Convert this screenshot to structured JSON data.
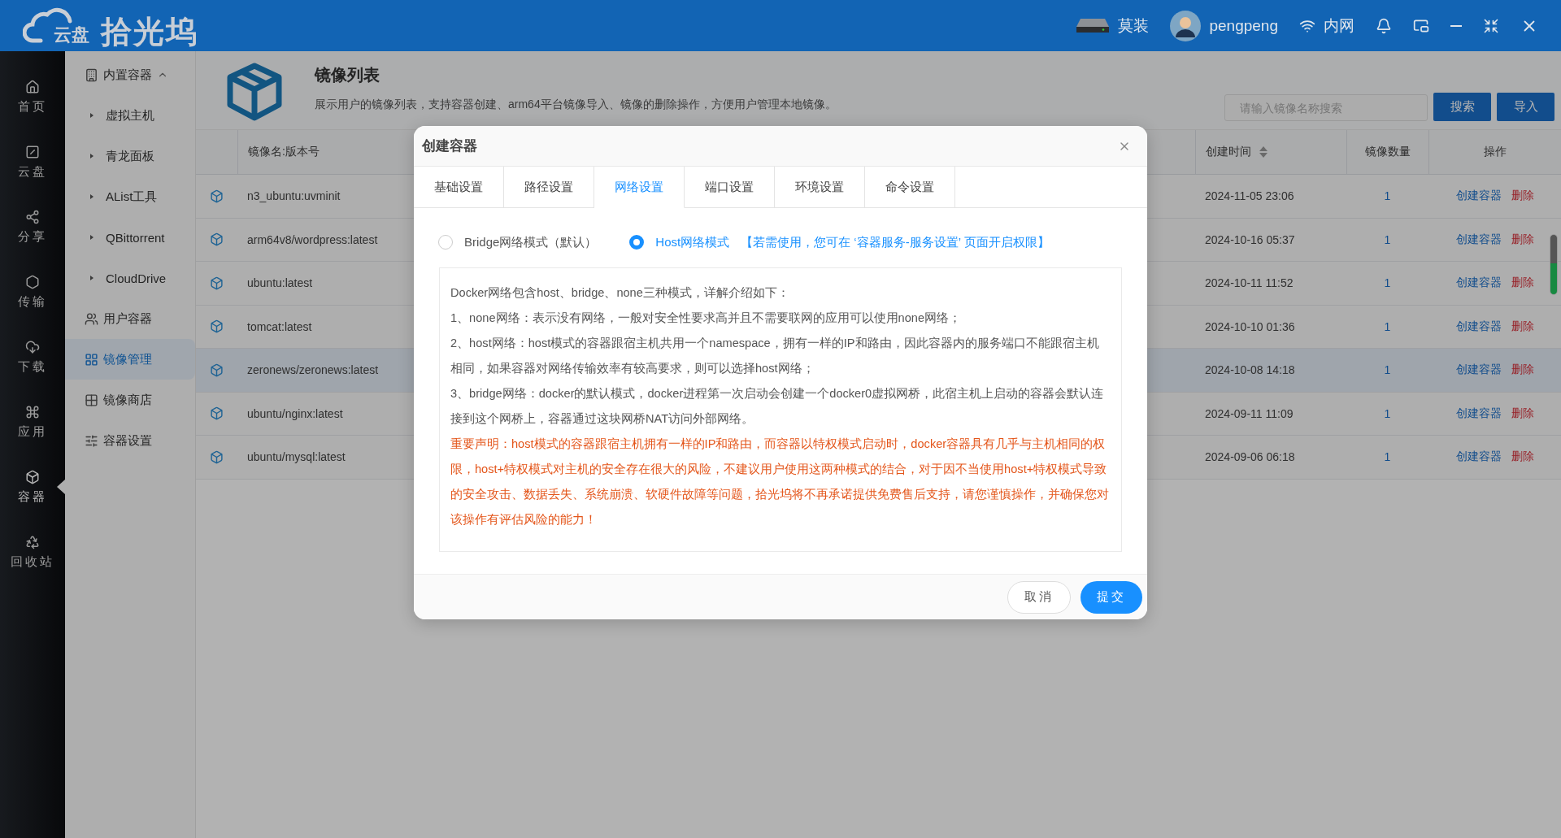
{
  "app": {
    "logo_badge": "云盘",
    "logo_text": "拾光坞"
  },
  "topbar": {
    "device": "莫装",
    "user": "pengpeng",
    "network": "内网"
  },
  "rail": [
    {
      "kind": "home",
      "label": "首页",
      "selected": false
    },
    {
      "kind": "disk",
      "label": "云盘",
      "selected": false
    },
    {
      "kind": "share",
      "label": "分享",
      "selected": false
    },
    {
      "kind": "transfer",
      "label": "传输",
      "selected": false
    },
    {
      "kind": "download",
      "label": "下载",
      "selected": false
    },
    {
      "kind": "apps",
      "label": "应用",
      "selected": false
    },
    {
      "kind": "container",
      "label": "容器",
      "selected": true
    },
    {
      "kind": "recycle",
      "label": "回收站",
      "selected": false
    }
  ],
  "menu": [
    {
      "kind": "builtin",
      "label": "内置容器",
      "expanded": true,
      "selected": false,
      "children": [
        {
          "label": "虚拟主机",
          "selected": false
        },
        {
          "label": "青龙面板",
          "selected": false
        },
        {
          "label": "AList工具",
          "selected": false
        },
        {
          "label": "QBittorrent",
          "selected": false
        },
        {
          "label": "CloudDrive",
          "selected": false
        }
      ]
    },
    {
      "kind": "users",
      "label": "用户容器",
      "selected": false
    },
    {
      "kind": "images",
      "label": "镜像管理",
      "selected": true
    },
    {
      "kind": "store",
      "label": "镜像商店",
      "selected": false
    },
    {
      "kind": "settings",
      "label": "容器设置",
      "selected": false
    }
  ],
  "page": {
    "title": "镜像列表",
    "description": "展示用户的镜像列表，支持容器创建、arm64平台镜像导入、镜像的删除操作，方便用户管理本地镜像。",
    "search": {
      "placeholder": "请输入镜像名称搜索"
    },
    "buttons": [
      "搜索",
      "导入"
    ]
  },
  "table": {
    "columns": [
      "镜像名:版本号",
      "创建时间",
      "镜像数量",
      "操作"
    ],
    "rows": [
      {
        "name": "n3_ubuntu:uvminit",
        "created": "2024-11-05 23:06",
        "count": "1",
        "actions": [
          "创建容器",
          "删除"
        ],
        "selected": false
      },
      {
        "name": "arm64v8/wordpress:latest",
        "created": "2024-10-16 05:37",
        "count": "1",
        "actions": [
          "创建容器",
          "删除"
        ],
        "selected": false
      },
      {
        "name": "ubuntu:latest",
        "created": "2024-10-11 11:52",
        "count": "1",
        "actions": [
          "创建容器",
          "删除"
        ],
        "selected": false
      },
      {
        "name": "tomcat:latest",
        "created": "2024-10-10 01:36",
        "count": "1",
        "actions": [
          "创建容器",
          "删除"
        ],
        "selected": false
      },
      {
        "name": "zeronews/zeronews:latest",
        "created": "2024-10-08 14:18",
        "count": "1",
        "actions": [
          "创建容器",
          "删除"
        ],
        "selected": true
      },
      {
        "name": "ubuntu/nginx:latest",
        "created": "2024-09-11 11:09",
        "count": "1",
        "actions": [
          "创建容器",
          "删除"
        ],
        "selected": false
      },
      {
        "name": "ubuntu/mysql:latest",
        "created": "2024-09-06 06:18",
        "count": "1",
        "actions": [
          "创建容器",
          "删除"
        ],
        "selected": false
      }
    ]
  },
  "dialog": {
    "title": "创建容器",
    "tabs": [
      {
        "label": "基础设置",
        "selected": false
      },
      {
        "label": "路径设置",
        "selected": false
      },
      {
        "label": "网络设置",
        "selected": true
      },
      {
        "label": "端口设置",
        "selected": false
      },
      {
        "label": "环境设置",
        "selected": false
      },
      {
        "label": "命令设置",
        "selected": false
      }
    ],
    "network_modes": [
      {
        "label": "Bridge网络模式（默认）",
        "selected": false
      },
      {
        "label": "Host网络模式",
        "note": "【若需使用，您可在 ‘容器服务-服务设置’ 页面开启权限】",
        "selected": true
      }
    ],
    "intro": [
      "Docker网络包含host、bridge、none三种模式，详解介绍如下：",
      "1、none网络：表示没有网络，一般对安全性要求高并且不需要联网的应用可以使用none网络；",
      "2、host网络：host模式的容器跟宿主机共用一个namespace，拥有一样的IP和路由，因此容器内的服务端口不能跟宿主机相同，如果容器对网络传输效率有较高要求，则可以选择host网络；",
      "3、bridge网络：docker的默认模式，docker进程第一次启动会创建一个docker0虚拟网桥，此宿主机上启动的容器会默认连接到这个网桥上，容器通过这块网桥NAT访问外部网络。"
    ],
    "warning": "重要声明：host模式的容器跟宿主机拥有一样的IP和路由，而容器以特权模式启动时，docker容器具有几乎与主机相同的权限，host+特权模式对主机的安全存在很大的风险，不建议用户使用这两种模式的结合，对于因不当使用host+特权模式导致的安全攻击、数据丢失、系统崩溃、软硬件故障等问题，拾光坞将不再承诺提供免费售后支持，请您谨慎操作，并确保您对该操作有评估风险的能力！",
    "buttons": [
      "取消",
      "提交"
    ]
  }
}
